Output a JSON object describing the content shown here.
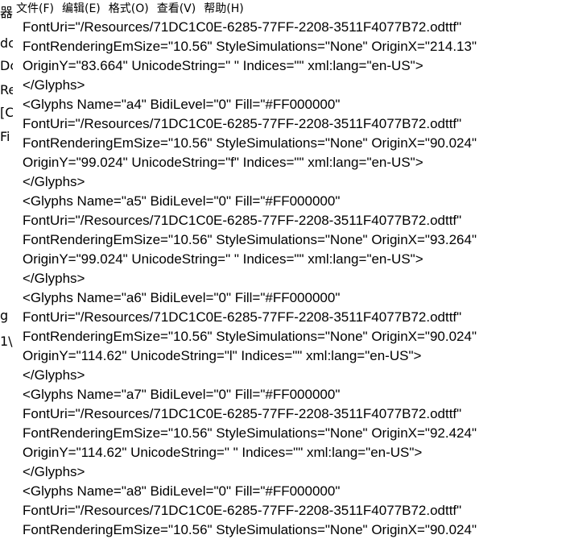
{
  "background_window": {
    "fragments": [
      "器",
      "dc",
      "Dc",
      "Re",
      "[C",
      "Fi",
      "g ,",
      "1\\"
    ]
  },
  "menu": {
    "items": [
      "文件(F)",
      "编辑(E)",
      "格式(O)",
      "查看(V)",
      "帮助(H)"
    ]
  },
  "editor": {
    "lines": [
      "FontUri=\"/Resources/71DC1C0E-6285-77FF-2208-3511F4077B72.odttf\"",
      "FontRenderingEmSize=\"10.56\" StyleSimulations=\"None\" OriginX=\"214.13\"",
      "OriginY=\"83.664\" UnicodeString=\" \" Indices=\"\" xml:lang=\"en-US\">",
      "</Glyphs>",
      "<Glyphs Name=\"a4\" BidiLevel=\"0\" Fill=\"#FF000000\"",
      "FontUri=\"/Resources/71DC1C0E-6285-77FF-2208-3511F4077B72.odttf\"",
      "FontRenderingEmSize=\"10.56\" StyleSimulations=\"None\" OriginX=\"90.024\"",
      "OriginY=\"99.024\" UnicodeString=\"f\" Indices=\"\" xml:lang=\"en-US\">",
      "</Glyphs>",
      "<Glyphs Name=\"a5\" BidiLevel=\"0\" Fill=\"#FF000000\"",
      "FontUri=\"/Resources/71DC1C0E-6285-77FF-2208-3511F4077B72.odttf\"",
      "FontRenderingEmSize=\"10.56\" StyleSimulations=\"None\" OriginX=\"93.264\"",
      "OriginY=\"99.024\" UnicodeString=\" \" Indices=\"\" xml:lang=\"en-US\">",
      "</Glyphs>",
      "<Glyphs Name=\"a6\" BidiLevel=\"0\" Fill=\"#FF000000\"",
      "FontUri=\"/Resources/71DC1C0E-6285-77FF-2208-3511F4077B72.odttf\"",
      "FontRenderingEmSize=\"10.56\" StyleSimulations=\"None\" OriginX=\"90.024\"",
      "OriginY=\"114.62\" UnicodeString=\"l\" Indices=\"\" xml:lang=\"en-US\">",
      "</Glyphs>",
      "<Glyphs Name=\"a7\" BidiLevel=\"0\" Fill=\"#FF000000\"",
      "FontUri=\"/Resources/71DC1C0E-6285-77FF-2208-3511F4077B72.odttf\"",
      "FontRenderingEmSize=\"10.56\" StyleSimulations=\"None\" OriginX=\"92.424\"",
      "OriginY=\"114.62\" UnicodeString=\" \" Indices=\"\" xml:lang=\"en-US\">",
      "</Glyphs>",
      "<Glyphs Name=\"a8\" BidiLevel=\"0\" Fill=\"#FF000000\"",
      "FontUri=\"/Resources/71DC1C0E-6285-77FF-2208-3511F4077B72.odttf\"",
      "FontRenderingEmSize=\"10.56\" StyleSimulations=\"None\" OriginX=\"90.024\""
    ]
  }
}
